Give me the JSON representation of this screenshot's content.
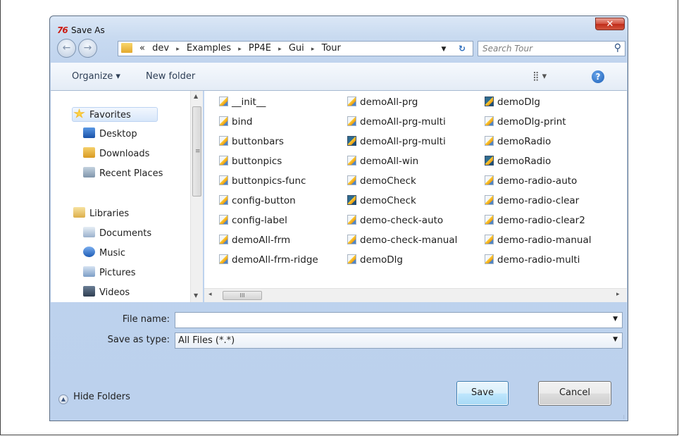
{
  "window": {
    "app_icon": "76",
    "title": "Save As",
    "close_glyph": "✕"
  },
  "nav": {
    "back_glyph": "←",
    "forward_glyph": "→",
    "breadcrumb_prefix": "«",
    "breadcrumbs": [
      "dev",
      "Examples",
      "PP4E",
      "Gui",
      "Tour"
    ],
    "separator_glyph": "▸",
    "dropdown_glyph": "▼",
    "refresh_glyph": "↻",
    "search_placeholder": "Search Tour",
    "search_glyph": "⚲"
  },
  "toolbar": {
    "organize": "Organize ▾",
    "new_folder": "New folder",
    "view_glyph": "⣿ ▾",
    "help_glyph": "?"
  },
  "sidebar": {
    "favorites": [
      {
        "label": "Favorites",
        "icon": "star-icon",
        "color": "#f2b61d",
        "selected": true
      },
      {
        "label": "Desktop",
        "icon": "desktop-icon",
        "color": "#2c6cc4"
      },
      {
        "label": "Downloads",
        "icon": "downloads-folder-icon",
        "color": "#e4a834"
      },
      {
        "label": "Recent Places",
        "icon": "recent-places-icon",
        "color": "#8aa0b6"
      }
    ],
    "libraries": [
      {
        "label": "Libraries",
        "icon": "libraries-icon",
        "color": "#e8c468"
      },
      {
        "label": "Documents",
        "icon": "documents-icon",
        "color": "#9eb6d2"
      },
      {
        "label": "Music",
        "icon": "music-icon",
        "color": "#3b77c9"
      },
      {
        "label": "Pictures",
        "icon": "pictures-icon",
        "color": "#82a4c9"
      },
      {
        "label": "Videos",
        "icon": "videos-icon",
        "color": "#4a5f78"
      }
    ],
    "scroll_up_glyph": "▲",
    "scroll_down_glyph": "▼",
    "grip_glyph": "≡"
  },
  "files": {
    "columns": [
      [
        {
          "name": "__init__",
          "icon": "python-file-icon"
        },
        {
          "name": "bind",
          "icon": "python-file-icon"
        },
        {
          "name": "buttonbars",
          "icon": "python-file-icon"
        },
        {
          "name": "buttonpics",
          "icon": "python-file-icon"
        },
        {
          "name": "buttonpics-func",
          "icon": "python-file-icon"
        },
        {
          "name": "config-button",
          "icon": "python-file-icon"
        },
        {
          "name": "config-label",
          "icon": "python-file-icon"
        },
        {
          "name": "demoAll-frm",
          "icon": "python-file-icon"
        },
        {
          "name": "demoAll-frm-ridge",
          "icon": "python-file-icon"
        }
      ],
      [
        {
          "name": "demoAll-prg",
          "icon": "python-file-icon"
        },
        {
          "name": "demoAll-prg-multi",
          "icon": "python-file-icon"
        },
        {
          "name": "demoAll-prg-multi",
          "icon": "compiled-python-icon"
        },
        {
          "name": "demoAll-win",
          "icon": "python-file-icon"
        },
        {
          "name": "demoCheck",
          "icon": "python-file-icon"
        },
        {
          "name": "demoCheck",
          "icon": "compiled-python-icon"
        },
        {
          "name": "demo-check-auto",
          "icon": "python-file-icon"
        },
        {
          "name": "demo-check-manual",
          "icon": "python-file-icon"
        },
        {
          "name": "demoDlg",
          "icon": "python-file-icon"
        }
      ],
      [
        {
          "name": "demoDlg",
          "icon": "compiled-python-icon"
        },
        {
          "name": "demoDlg-print",
          "icon": "python-file-icon"
        },
        {
          "name": "demoRadio",
          "icon": "python-file-icon"
        },
        {
          "name": "demoRadio",
          "icon": "compiled-python-icon"
        },
        {
          "name": "demo-radio-auto",
          "icon": "python-file-icon"
        },
        {
          "name": "demo-radio-clear",
          "icon": "python-file-icon"
        },
        {
          "name": "demo-radio-clear2",
          "icon": "python-file-icon"
        },
        {
          "name": "demo-radio-manual",
          "icon": "python-file-icon"
        },
        {
          "name": "demo-radio-multi",
          "icon": "python-file-icon"
        }
      ]
    ],
    "scroll_left_glyph": "◂",
    "scroll_right_glyph": "▸",
    "thumb_glyph": "III"
  },
  "form": {
    "file_name_label": "File name:",
    "file_name_value": "",
    "save_type_label": "Save as type:",
    "save_type_value": "All Files (*.*)",
    "dropdown_glyph": "▼"
  },
  "footer": {
    "hide_folders": "Hide Folders",
    "hide_folders_glyph": "▲",
    "save": "Save",
    "cancel": "Cancel",
    "resize_glyph": "⁝"
  }
}
